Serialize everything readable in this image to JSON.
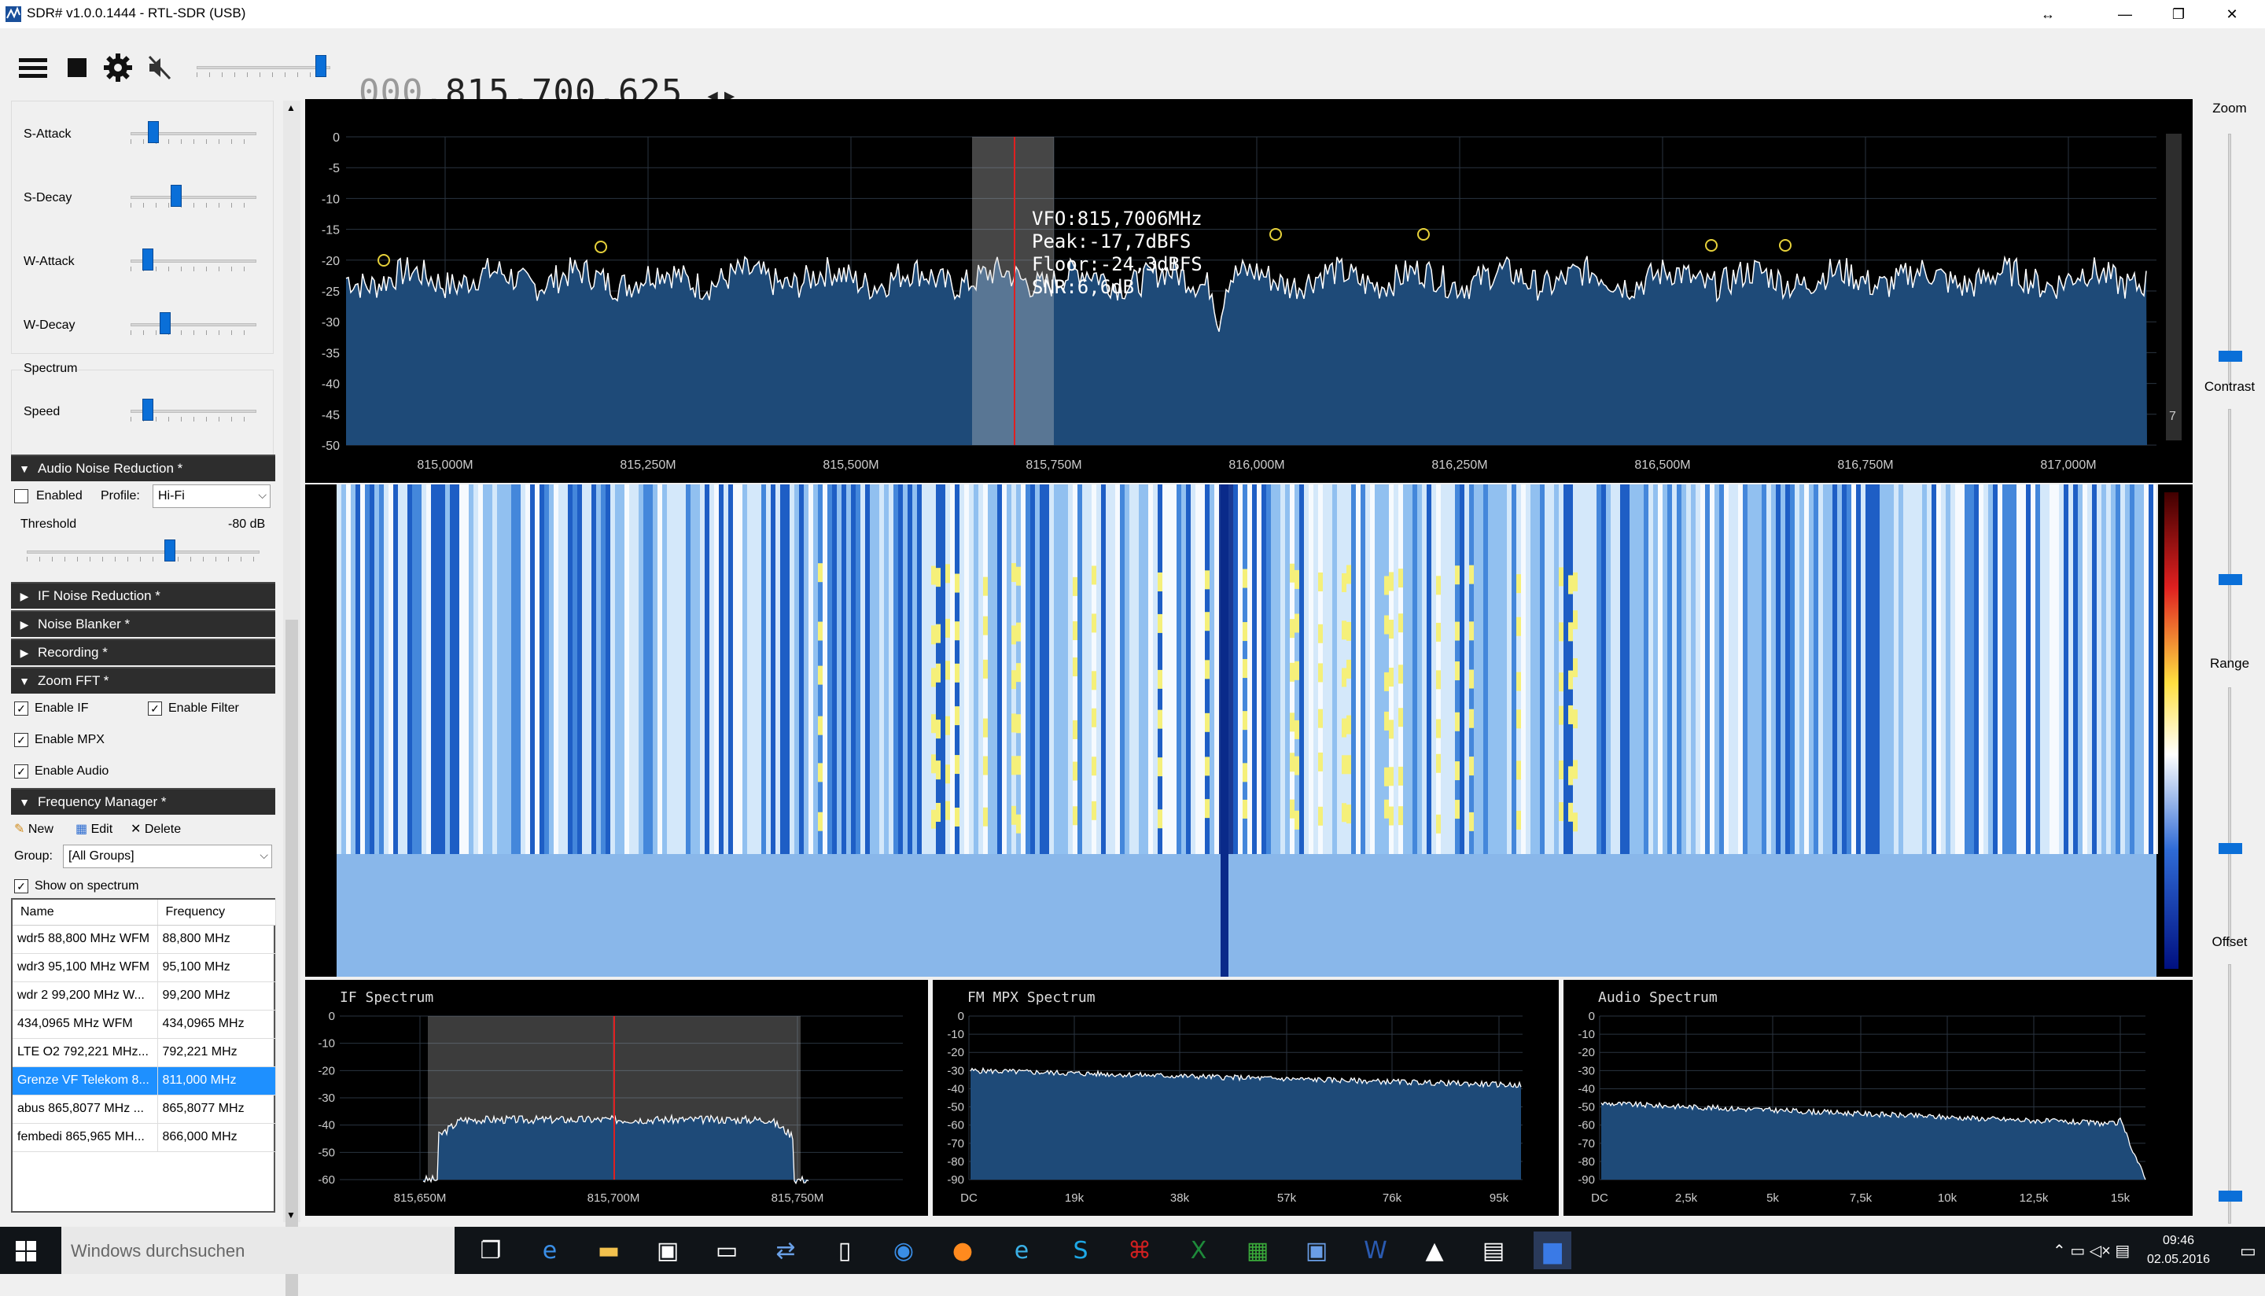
{
  "window": {
    "title": "SDR# v1.0.0.1444 - RTL-SDR (USB)",
    "controls": [
      "↔",
      "—",
      "❐",
      "✕"
    ]
  },
  "toolbar": {
    "menu_icon": "hamburger-menu-icon",
    "stop_icon": "stop-icon",
    "settings_icon": "gear-icon",
    "mute_icon": "speaker-mute-icon",
    "freq_dim": "000.",
    "freq_main": "815.700.625",
    "freq_arrows": "◂▸",
    "volume_level": 0.97
  },
  "leftpanel": {
    "agc": [
      {
        "label": "S-Attack",
        "value": 0.15
      },
      {
        "label": "S-Decay",
        "value": 0.35
      },
      {
        "label": "W-Attack",
        "value": 0.1
      },
      {
        "label": "W-Decay",
        "value": 0.25
      }
    ],
    "spectrum_group": "Spectrum",
    "speed": {
      "label": "Speed",
      "value": 0.1
    },
    "anr": {
      "header": "Audio Noise Reduction *",
      "enabled_label": "Enabled",
      "enabled": false,
      "profile_label": "Profile:",
      "profile_value": "Hi-Fi",
      "threshold_label": "Threshold",
      "threshold_value": "-80 dB",
      "threshold_level": 0.62
    },
    "collapsed": [
      "IF Noise Reduction *",
      "Noise Blanker *",
      "Recording *"
    ],
    "zoomfft": {
      "header": "Zoom FFT *",
      "enable_if": "Enable IF",
      "enable_filter": "Enable Filter",
      "enable_mpx": "Enable MPX",
      "enable_audio": "Enable Audio"
    },
    "freqmgr": {
      "header": "Frequency Manager *",
      "new": "New",
      "edit": "Edit",
      "delete": "Delete",
      "group_label": "Group:",
      "group_value": "[All Groups]",
      "show_on_spectrum": "Show on spectrum",
      "col_name": "Name",
      "col_freq": "Frequency",
      "rows": [
        {
          "name": "wdr5 88,800 MHz WFM",
          "freq": "88,800 MHz"
        },
        {
          "name": "wdr3 95,100 MHz WFM",
          "freq": "95,100 MHz"
        },
        {
          "name": "wdr 2 99,200 MHz W...",
          "freq": "99,200 MHz"
        },
        {
          "name": "434,0965 MHz WFM",
          "freq": "434,0965 MHz"
        },
        {
          "name": "LTE O2 792,221 MHz...",
          "freq": "792,221 MHz"
        },
        {
          "name": "Grenze VF Telekom 8...",
          "freq": "811,000 MHz"
        },
        {
          "name": "abus 865,8077 MHz ...",
          "freq": "865,8077 MHz"
        },
        {
          "name": "fembedi 865,965 MH...",
          "freq": "866,000 MHz"
        }
      ],
      "selected_index": 5
    }
  },
  "mainspectrum": {
    "y_ticks": [
      "0",
      "-5",
      "-10",
      "-15",
      "-20",
      "-25",
      "-30",
      "-35",
      "-40",
      "-45",
      "-50"
    ],
    "x_ticks": [
      "815,000M",
      "815,250M",
      "815,500M",
      "815,750M",
      "816,000M",
      "816,250M",
      "816,500M",
      "816,750M",
      "817,000M"
    ],
    "tooltip": [
      "VFO:815,7006MHz",
      "Peak:-17,7dBFS",
      "Floor:-24,3dBFS",
      "SNR:6,6dB"
    ],
    "scale_label": "7"
  },
  "ifspectrum": {
    "title": "IF Spectrum",
    "y_ticks": [
      "0",
      "-10",
      "-20",
      "-30",
      "-40",
      "-50",
      "-60"
    ],
    "x_ticks": [
      "815,650M",
      "815,700M",
      "815,750M"
    ]
  },
  "mpxspectrum": {
    "title": "FM MPX Spectrum",
    "y_ticks": [
      "0",
      "-10",
      "-20",
      "-30",
      "-40",
      "-50",
      "-60",
      "-70",
      "-80",
      "-90"
    ],
    "x_ticks": [
      "DC",
      "19k",
      "38k",
      "57k",
      "76k",
      "95k"
    ]
  },
  "audiospectrum": {
    "title": "Audio Spectrum",
    "y_ticks": [
      "0",
      "-10",
      "-20",
      "-30",
      "-40",
      "-50",
      "-60",
      "-70",
      "-80",
      "-90"
    ],
    "x_ticks": [
      "DC",
      "2,5k",
      "5k",
      "7,5k",
      "10k",
      "12,5k",
      "15k"
    ]
  },
  "rightctl": {
    "zoom": "Zoom",
    "contrast": "Contrast",
    "range": "Range",
    "offset": "Offset"
  },
  "taskbar": {
    "search_placeholder": "Windows durchsuchen",
    "time": "09:46",
    "date": "02.05.2016"
  },
  "colors": {
    "spectrum_fill": "#1e4a78",
    "accent": "#0a6fd8",
    "vfo_line": "#e02020"
  }
}
